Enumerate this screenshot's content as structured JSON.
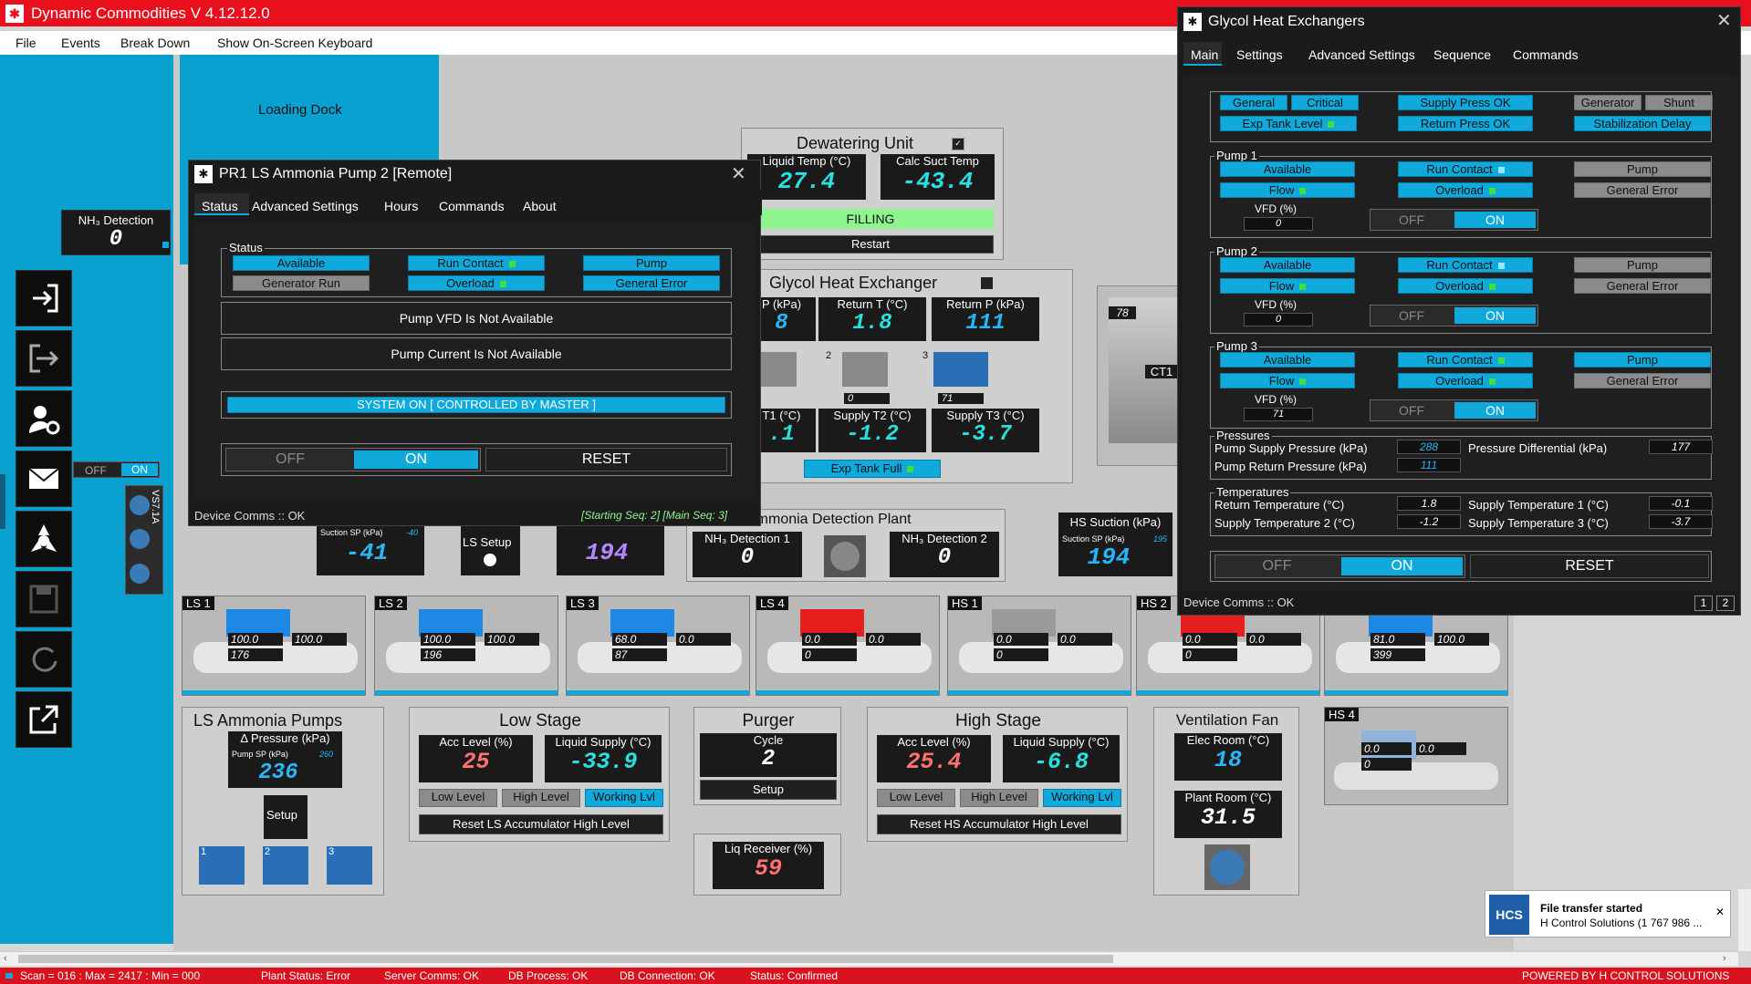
{
  "app": {
    "title": "Dynamic Commodities V 4.12.12.0",
    "logo": "plant-logo-icon"
  },
  "menu": [
    "File",
    "Events",
    "Break Down",
    "Show On-Screen Keyboard"
  ],
  "loading_dock": "Loading Dock",
  "nh3_left": {
    "label": "NH₃ Detection",
    "value": "0"
  },
  "side_toggle": {
    "off": "OFF",
    "on": "ON",
    "vs_label": "VS7.1A"
  },
  "dewatering": {
    "title": "Dewatering Unit",
    "liquid_temp_label": "Liquid Temp (°C)",
    "liquid_temp": "27.4",
    "calc_suct_label": "Calc Suct Temp",
    "calc_suct": "-43.4",
    "status": "FILLING",
    "restart": "Restart"
  },
  "glycol_hx": {
    "title": "Glycol Heat Exchanger",
    "supply_p_label": "P (kPa)",
    "supply_p": "8",
    "return_t_label": "Return T (°C)",
    "return_t": "1.8",
    "return_p_label": "Return P (kPa)",
    "return_p": "111",
    "pump_nums": [
      "2",
      "3"
    ],
    "pump_pct": [
      "%",
      "0",
      "71"
    ],
    "supply_t1_label": "T1 (°C)",
    "supply_t1": ".1",
    "supply_t2_label": "Supply T2 (°C)",
    "supply_t2": "-1.2",
    "supply_t3_label": "Supply T3 (°C)",
    "supply_t3": "-3.7",
    "exp_tank": "Exp Tank Full"
  },
  "ct1": {
    "label": "CT1",
    "value": "78"
  },
  "pump_window": {
    "title": "PR1 LS Ammonia Pump 2 [Remote]",
    "tabs": [
      "Status",
      "Advanced Settings",
      "Hours",
      "Commands",
      "About"
    ],
    "status_label": "Status",
    "status_buttons": [
      "Available",
      "Run Contact",
      "Pump",
      "Generator Run",
      "Overload",
      "General Error"
    ],
    "vfd_msg": "Pump VFD Is Not Available",
    "current_msg": "Pump Current Is Not Available",
    "system_msg": "SYSTEM ON [ CONTROLLED BY MASTER ]",
    "off": "OFF",
    "on": "ON",
    "reset": "RESET",
    "comms": "Device Comms :: OK",
    "seq": "[Starting Seq: 2]  [Main Seq: 3]"
  },
  "glycol_window": {
    "title": "Glycol Heat Exchangers",
    "tabs": [
      "Main",
      "Settings",
      "Advanced Settings",
      "Sequence",
      "Commands"
    ],
    "top_buttons": [
      "General",
      "Critical",
      "Supply Press OK",
      "Generator",
      "Shunt",
      "Exp Tank Level",
      "Return Press OK",
      "Stabilization Delay"
    ],
    "pumps": [
      {
        "name": "Pump 1",
        "vfd": "0",
        "buttons": [
          "Available",
          "Run Contact",
          "Pump",
          "Flow",
          "Overload",
          "General Error"
        ],
        "pump_active": false
      },
      {
        "name": "Pump 2",
        "vfd": "0",
        "buttons": [
          "Available",
          "Run Contact",
          "Pump",
          "Flow",
          "Overload",
          "General Error"
        ],
        "pump_active": false
      },
      {
        "name": "Pump 3",
        "vfd": "71",
        "buttons": [
          "Available",
          "Run Contact",
          "Pump",
          "Flow",
          "Overload",
          "General Error"
        ],
        "pump_active": true
      }
    ],
    "vfd_label": "VFD (%)",
    "off": "OFF",
    "on": "ON",
    "pressures": {
      "title": "Pressures",
      "supply_label": "Pump Supply Pressure (kPa)",
      "supply": "288",
      "return_label": "Pump Return Pressure (kPa)",
      "return": "111",
      "diff_label": "Pressure Differential (kPa)",
      "diff": "177"
    },
    "temps": {
      "title": "Temperatures",
      "return_label": "Return Temperature (°C)",
      "return": "1.8",
      "s1_label": "Supply Temperature 1 (°C)",
      "s1": "-0.1",
      "s2_label": "Supply Temperature 2 (°C)",
      "s2": "-1.2",
      "s3_label": "Supply Temperature 3 (°C)",
      "s3": "-3.7"
    },
    "reset": "RESET",
    "comms": "Device Comms :: OK",
    "pages": [
      "1",
      "2"
    ]
  },
  "suction_row": {
    "sp_label": "Suction SP (kPa)",
    "ls_sp": "-40",
    "ls_val": "-41",
    "ls_setup": "LS Setup",
    "mid_val": "194",
    "hs_label": "HS Suction (kPa)",
    "hs_sp": "195",
    "hs_val": "194"
  },
  "nh3_plant": {
    "title": "Ammonia Detection Plant",
    "d1_label": "NH₃ Detection 1",
    "d1": "0",
    "d2_label": "NH₃ Detection 2",
    "d2": "0"
  },
  "compressors": [
    {
      "name": "LS 1",
      "a": "100.0",
      "b": "100.0",
      "amps": "176",
      "color": "#1e88e5"
    },
    {
      "name": "LS 2",
      "a": "100.0",
      "b": "100.0",
      "amps": "196",
      "color": "#1e88e5"
    },
    {
      "name": "LS 3",
      "a": "68.0",
      "b": "0.0",
      "amps": "87",
      "color": "#1e88e5"
    },
    {
      "name": "LS 4",
      "a": "0.0",
      "b": "0.0",
      "amps": "0",
      "color": "#e51e1e"
    },
    {
      "name": "HS 1",
      "a": "0.0",
      "b": "0.0",
      "amps": "0",
      "color": "#9a9a9a"
    },
    {
      "name": "HS 2",
      "a": "0.0",
      "b": "0.0",
      "amps": "0",
      "color": "#e51e1e"
    },
    {
      "name": "",
      "a": "81.0",
      "b": "100.0",
      "amps": "399",
      "color": "#1e88e5"
    }
  ],
  "hs4": {
    "name": "HS 4",
    "a": "0.0",
    "b": "0.0",
    "amps": "0"
  },
  "ls_pumps": {
    "title": "LS Ammonia Pumps",
    "dp_label": "Δ Pressure (kPa)",
    "sp_label": "Pump SP (kPa)",
    "sp": "260",
    "value": "236",
    "setup": "Setup",
    "pump_ids": [
      "1",
      "2",
      "3"
    ]
  },
  "low_stage": {
    "title": "Low Stage",
    "acc_label": "Acc Level (%)",
    "acc": "25",
    "liq_label": "Liquid Supply (°C)",
    "liq": "-33.9",
    "buttons": [
      "Low Level",
      "High Level",
      "Working Lvl"
    ],
    "reset": "Reset LS Accumulator High Level"
  },
  "purger": {
    "title": "Purger",
    "cycle_label": "Cycle",
    "cycle": "2",
    "setup": "Setup"
  },
  "liq_receiver": {
    "label": "Liq Receiver (%)",
    "value": "59"
  },
  "high_stage": {
    "title": "High Stage",
    "acc_label": "Acc Level (%)",
    "acc": "25.4",
    "liq_label": "Liquid Supply (°C)",
    "liq": "-6.8",
    "buttons": [
      "Low Level",
      "High Level",
      "Working Lvl"
    ],
    "reset": "Reset HS Accumulator High Level"
  },
  "vent_fan": {
    "title": "Ventilation Fan",
    "elec_label": "Elec Room (°C)",
    "elec": "18",
    "plant_label": "Plant Room (°C)",
    "plant": "31.5"
  },
  "toast": {
    "title": "File transfer started",
    "body": "H Control Solutions (1 767 986 ...",
    "logo": "HCS"
  },
  "status": {
    "scan": "Scan = 016 : Max = 2417 : Min = 000",
    "plant": "Plant Status: Error",
    "server": "Server Comms: OK",
    "db_process": "DB Process:  OK",
    "db_conn": "DB Connection:  OK",
    "status": "Status:  Confirmed",
    "powered": "POWERED BY H CONTROL SOLUTIONS"
  }
}
